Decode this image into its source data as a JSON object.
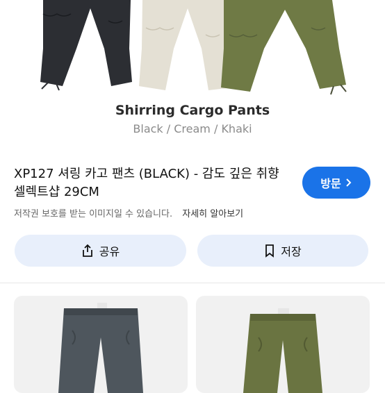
{
  "hero": {
    "title": "Shirring Cargo Pants",
    "subtitle": "Black / Cream / Khaki",
    "pants_colors": [
      "#2c2e33",
      "#e4e0d4",
      "#6f7a45"
    ]
  },
  "result": {
    "title": "XP127 셔링 카고 팬츠 (BLACK) - 감도 깊은 취향 셀렉트샵 29CM",
    "visit_label": "방문",
    "copyright_text": "저작권 보호를 받는 이미지일 수 있습니다.",
    "learn_more_label": "자세히 알아보기"
  },
  "actions": {
    "share_label": "공유",
    "save_label": "저장"
  },
  "thumbnails": {
    "left_color": "#4e565d",
    "right_color": "#6a7441"
  },
  "colors": {
    "accent": "#1a73e8",
    "action_bg": "#e8effb"
  }
}
